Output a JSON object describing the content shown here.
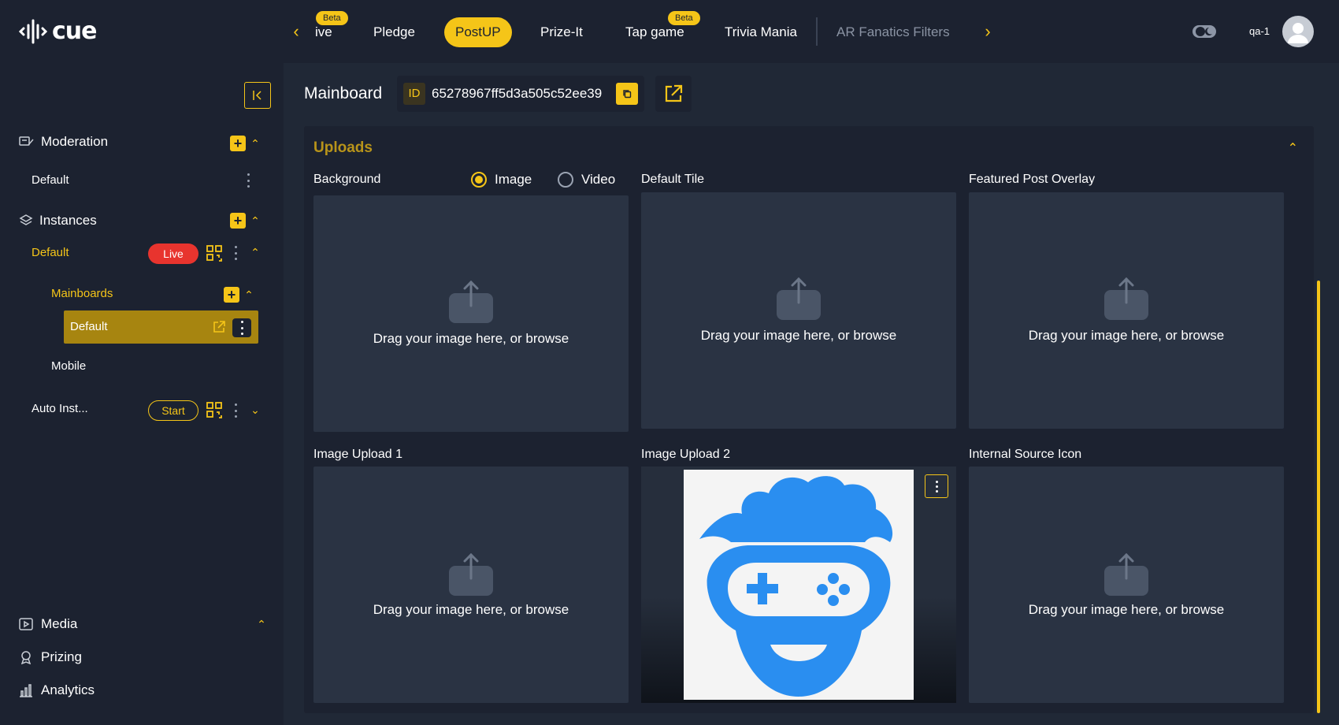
{
  "app": {
    "logo_text": "cue"
  },
  "tabs": [
    {
      "label": "ive",
      "beta": "Beta"
    },
    {
      "label": "Pledge"
    },
    {
      "label": "PostUP",
      "active": true
    },
    {
      "label": "Prize-It"
    },
    {
      "label": "Tap game",
      "beta": "Beta"
    },
    {
      "label": "Trivia Mania"
    },
    {
      "label": "AR Fanatics Filters"
    }
  ],
  "user": {
    "name": "qa-1"
  },
  "sidebar": {
    "moderation": {
      "title": "Moderation",
      "items": [
        "Default"
      ]
    },
    "instances": {
      "title": "Instances",
      "default": {
        "label": "Default",
        "status": "Live"
      },
      "mainboards": {
        "label": "Mainboards",
        "items": [
          "Default",
          "Mobile"
        ]
      },
      "auto": {
        "label": "Auto Inst...",
        "action": "Start"
      }
    },
    "bottom": {
      "media": "Media",
      "prizing": "Prizing",
      "analytics": "Analytics"
    }
  },
  "main": {
    "title": "Mainboard",
    "id_badge": "ID",
    "id_value": "65278967ff5d3a505c52ee39"
  },
  "uploads": {
    "title": "Uploads",
    "background_label": "Background",
    "radio_image": "Image",
    "radio_video": "Video",
    "selected": "Image",
    "drop_text": "Drag your image here, or browse",
    "fields": {
      "default_tile": "Default Tile",
      "featured_post_overlay": "Featured Post Overlay",
      "image_upload_1": "Image Upload 1",
      "image_upload_2": "Image Upload 2",
      "internal_source_icon": "Internal Source Icon"
    }
  },
  "colors": {
    "accent": "#f5c518",
    "live": "#e8342e",
    "panel": "#1c2230",
    "dropzone": "#2a3343",
    "preview_blue": "#2a8ef0"
  }
}
